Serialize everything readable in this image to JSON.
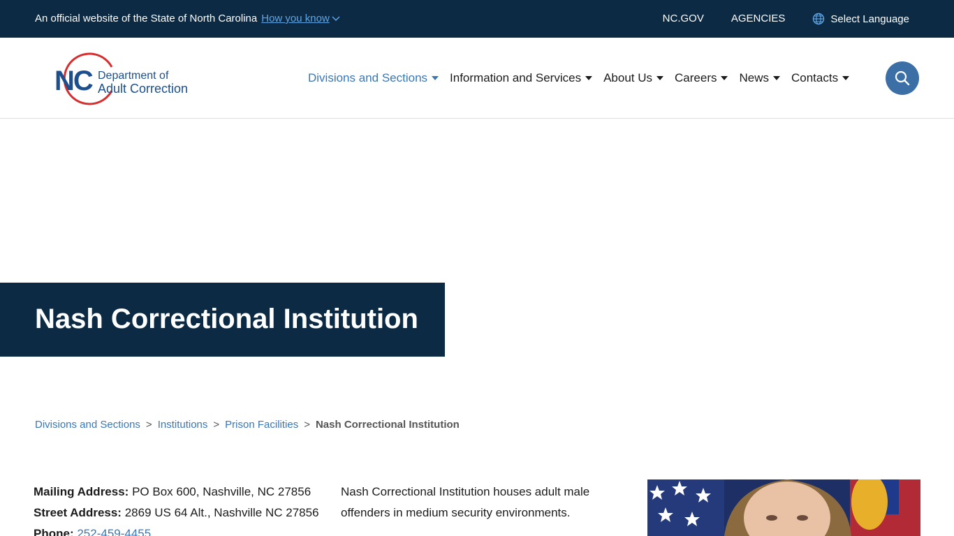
{
  "topbar": {
    "official_text": "An official website of the State of North Carolina",
    "how_you_know": "How you know",
    "links": {
      "ncgov": "NC.GOV",
      "agencies": "AGENCIES",
      "language": "Select Language"
    }
  },
  "logo": {
    "nc": "NC",
    "line1": "Department of",
    "line2": "Adult Correction"
  },
  "nav": {
    "items": [
      {
        "label": "Divisions and Sections"
      },
      {
        "label": "Information and Services"
      },
      {
        "label": "About Us"
      },
      {
        "label": "Careers"
      },
      {
        "label": "News"
      },
      {
        "label": "Contacts"
      }
    ]
  },
  "page": {
    "title": "Nash Correctional Institution"
  },
  "breadcrumb": {
    "items": [
      "Divisions and Sections",
      "Institutions",
      "Prison Facilities"
    ],
    "separator": ">",
    "current": "Nash Correctional Institution"
  },
  "contact": {
    "mailing_label": "Mailing Address:",
    "mailing_value": "PO Box 600, Nashville, NC 27856",
    "street_label": "Street Address:",
    "street_value": "2869 US 64 Alt., Nashville NC 27856",
    "phone_label": "Phone:",
    "phone_value": "252-459-4455"
  },
  "description": "Nash Correctional Institution houses adult male offenders in medium security environments.",
  "colors": {
    "navy": "#0c2a44",
    "accent_blue": "#3a77b5",
    "logo_red": "#d62e2e"
  }
}
